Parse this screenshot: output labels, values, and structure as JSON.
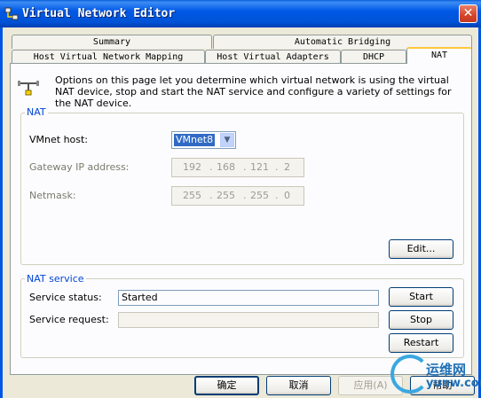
{
  "window": {
    "title": "Virtual Network Editor",
    "close_glyph": "✕"
  },
  "tabs": {
    "row1": [
      "Summary",
      "Automatic Bridging"
    ],
    "row2": [
      "Host Virtual Network Mapping",
      "Host Virtual Adapters",
      "DHCP",
      "NAT"
    ],
    "active": "NAT"
  },
  "intro": "Options on this page let you determine which virtual network is using the virtual NAT device, stop and start the NAT service and configure a variety of settings for the NAT device.",
  "nat": {
    "group_title": "NAT",
    "vmnet_label": "VMnet host:",
    "vmnet_value": "VMnet8",
    "gateway_label": "Gateway IP address:",
    "gateway_ip": [
      "192",
      "168",
      "121",
      "2"
    ],
    "netmask_label": "Netmask:",
    "netmask": [
      "255",
      "255",
      "255",
      "0"
    ],
    "ip_dot": ".",
    "edit_button": "Edit..."
  },
  "service": {
    "group_title": "NAT service",
    "status_label": "Service status:",
    "status_value": "Started",
    "request_label": "Service request:",
    "request_value": "",
    "start_button": "Start",
    "stop_button": "Stop",
    "restart_button": "Restart"
  },
  "footer": {
    "ok": "确定",
    "cancel": "取消",
    "apply": "应用(A)",
    "help": "帮助"
  },
  "watermark": {
    "cn": "运维网",
    "en": "yunw.com"
  },
  "icons": {
    "app": "network-editor-icon",
    "info": "network-connector-icon"
  },
  "colors": {
    "titlebar": "#0054e3",
    "accent_tab": "#ffc83c",
    "group_title": "#0046d5",
    "selection": "#316ac5"
  }
}
